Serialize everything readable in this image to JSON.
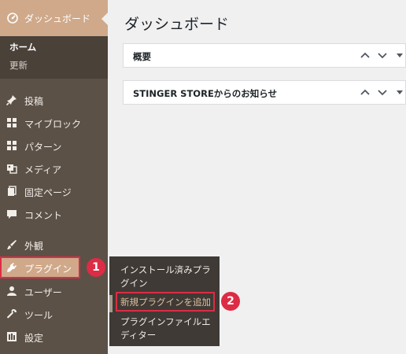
{
  "sidebar": {
    "dashboard_label": "ダッシュボード",
    "submenu": {
      "home": "ホーム",
      "update": "更新"
    },
    "items": [
      {
        "label": "投稿",
        "icon": "pin-icon"
      },
      {
        "label": "マイブロック",
        "icon": "grid-icon"
      },
      {
        "label": "パターン",
        "icon": "grid-icon"
      },
      {
        "label": "メディア",
        "icon": "media-icon"
      },
      {
        "label": "固定ページ",
        "icon": "page-icon"
      },
      {
        "label": "コメント",
        "icon": "comment-icon"
      },
      {
        "label": "外観",
        "icon": "brush-icon"
      },
      {
        "label": "プラグイン",
        "icon": "plugin-icon"
      },
      {
        "label": "ユーザー",
        "icon": "user-icon"
      },
      {
        "label": "ツール",
        "icon": "wrench-icon"
      },
      {
        "label": "設定",
        "icon": "settings-icon"
      }
    ]
  },
  "flyout": {
    "items": [
      "インストール済みプラグイン",
      "新規プラグインを追加",
      "プラグインファイルエディター"
    ]
  },
  "annotations": {
    "badge1": "1",
    "badge2": "2"
  },
  "main": {
    "title": "ダッシュボード",
    "panels": [
      {
        "title": "概要"
      },
      {
        "title": "STINGER STOREからのお知らせ"
      }
    ]
  },
  "colors": {
    "sidebar_bg": "#5b5147",
    "accent": "#cfa98a",
    "highlight_red": "#dd2c45",
    "flyout_bg": "#3f3a35"
  }
}
